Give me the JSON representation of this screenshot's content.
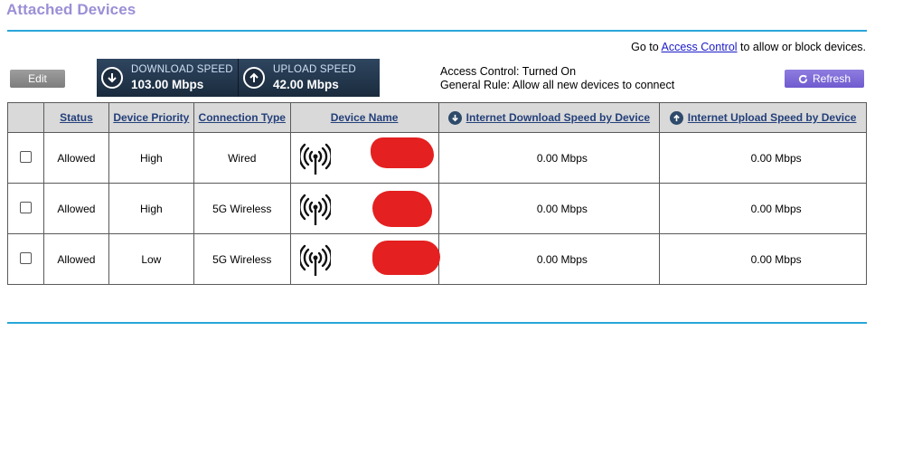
{
  "page": {
    "title": "Attached Devices"
  },
  "access_link": {
    "prefix": "Go to ",
    "link": "Access Control",
    "suffix": " to allow or block devices."
  },
  "buttons": {
    "edit": "Edit",
    "refresh": "Refresh"
  },
  "speed": {
    "download_label": "DOWNLOAD SPEED",
    "download_value": "103.00 Mbps",
    "upload_label": "UPLOAD SPEED",
    "upload_value": "42.00 Mbps"
  },
  "access_info": {
    "line1": "Access Control: Turned On",
    "line2": "General Rule: Allow all new devices to connect"
  },
  "table": {
    "headers": {
      "status": "Status",
      "priority": "Device Priority",
      "connection": "Connection Type",
      "name": "Device Name",
      "download": "Internet Download Speed by Device",
      "upload": "Internet Upload Speed by Device"
    },
    "rows": [
      {
        "status": "Allowed",
        "priority": "High",
        "connection": "Wired",
        "download": "0.00 Mbps",
        "upload": "0.00 Mbps"
      },
      {
        "status": "Allowed",
        "priority": "High",
        "connection": "5G Wireless",
        "download": "0.00 Mbps",
        "upload": "0.00 Mbps"
      },
      {
        "status": "Allowed",
        "priority": "Low",
        "connection": "5G Wireless",
        "download": "0.00 Mbps",
        "upload": "0.00 Mbps"
      }
    ]
  },
  "icons": {
    "download": "download-arrow-icon",
    "upload": "upload-arrow-icon",
    "refresh": "refresh-icon",
    "device": "wireless-antenna-icon"
  },
  "colors": {
    "accent_rule": "#29a6d8",
    "title": "#9b8fd6",
    "refresh_button": "#7a67d6",
    "redaction": "#e42020"
  }
}
